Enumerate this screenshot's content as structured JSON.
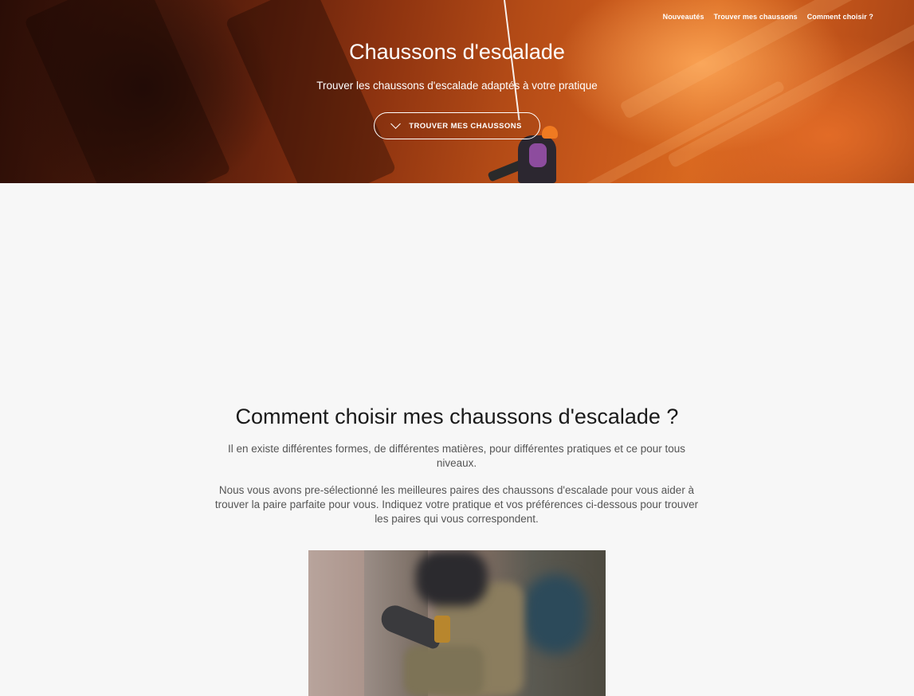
{
  "nav": {
    "items": [
      "Nouveautés",
      "Trouver mes chaussons",
      "Comment choisir ?"
    ]
  },
  "hero": {
    "title": "Chaussons d'escalade",
    "subtitle": "Trouver les chaussons d'escalade adaptés à votre pratique",
    "button_label": "TROUVER MES CHAUSSONS",
    "button_icon": "chevron-down-icon"
  },
  "main": {
    "title": "Comment choisir mes chaussons d'escalade ?",
    "paragraph_1": "Il en existe différentes formes, de différentes matières, pour différentes pratiques et ce pour tous niveaux.",
    "paragraph_2": "Nous vous avons pre-sélectionné les meilleures paires des chaussons d'escalade pour vous aider à trouver la paire parfaite pour vous. Indiquez votre pratique et vos préférences ci-dessous pour trouver les paires qui vous correspondent."
  },
  "colors": {
    "hero_accent": "#c9591b",
    "page_background": "#f7f7f7",
    "text_dark": "#1a1a1a",
    "text_muted": "#555555"
  }
}
